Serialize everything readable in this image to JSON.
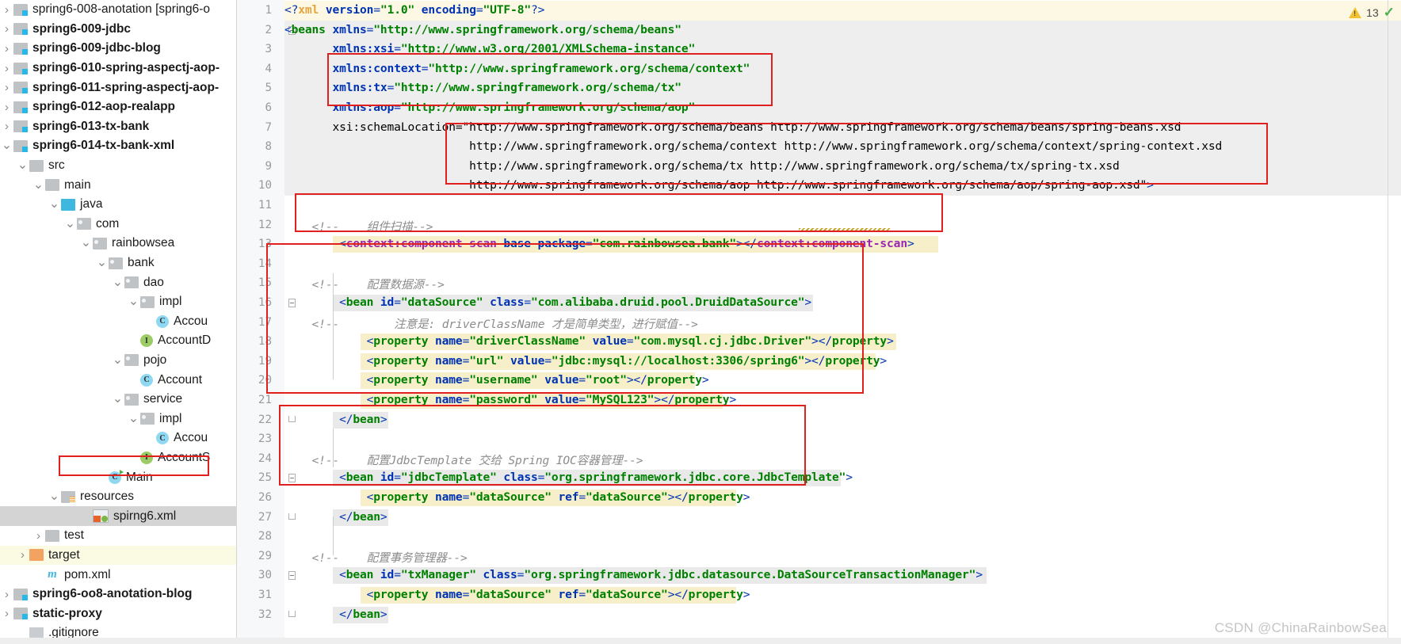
{
  "sidebar": {
    "items": [
      {
        "label": "spring6-008-anotation [spring6-o",
        "indent": 0,
        "arrow": "right",
        "icon": "module-folder-icon",
        "bold": false,
        "state": "normal"
      },
      {
        "label": "spring6-009-jdbc",
        "indent": 0,
        "arrow": "right",
        "icon": "module-folder-icon",
        "bold": true,
        "state": "normal"
      },
      {
        "label": "spring6-009-jdbc-blog",
        "indent": 0,
        "arrow": "right",
        "icon": "module-folder-icon",
        "bold": true,
        "state": "normal"
      },
      {
        "label": "spring6-010-spring-aspectj-aop-",
        "indent": 0,
        "arrow": "right",
        "icon": "module-folder-icon",
        "bold": true,
        "state": "normal"
      },
      {
        "label": "spring6-011-spring-aspectj-aop-",
        "indent": 0,
        "arrow": "right",
        "icon": "module-folder-icon",
        "bold": true,
        "state": "normal"
      },
      {
        "label": "spring6-012-aop-realapp",
        "indent": 0,
        "arrow": "right",
        "icon": "module-folder-icon",
        "bold": true,
        "state": "normal"
      },
      {
        "label": "spring6-013-tx-bank",
        "indent": 0,
        "arrow": "right",
        "icon": "module-folder-icon",
        "bold": true,
        "state": "normal"
      },
      {
        "label": "spring6-014-tx-bank-xml",
        "indent": 0,
        "arrow": "down",
        "icon": "module-folder-icon",
        "bold": true,
        "state": "normal"
      },
      {
        "label": "src",
        "indent": 1,
        "arrow": "down",
        "icon": "folder-icon",
        "bold": false,
        "state": "normal"
      },
      {
        "label": "main",
        "indent": 2,
        "arrow": "down",
        "icon": "folder-icon",
        "bold": false,
        "state": "normal"
      },
      {
        "label": "java",
        "indent": 3,
        "arrow": "down",
        "icon": "source-root-icon",
        "bold": false,
        "state": "normal"
      },
      {
        "label": "com",
        "indent": 4,
        "arrow": "down",
        "icon": "package-icon",
        "bold": false,
        "state": "normal"
      },
      {
        "label": "rainbowsea",
        "indent": 5,
        "arrow": "down",
        "icon": "package-icon",
        "bold": false,
        "state": "normal"
      },
      {
        "label": "bank",
        "indent": 6,
        "arrow": "down",
        "icon": "package-icon",
        "bold": false,
        "state": "normal"
      },
      {
        "label": "dao",
        "indent": 7,
        "arrow": "down",
        "icon": "package-icon",
        "bold": false,
        "state": "normal"
      },
      {
        "label": "impl",
        "indent": 8,
        "arrow": "down",
        "icon": "package-icon",
        "bold": false,
        "state": "normal"
      },
      {
        "label": "Accou",
        "indent": 9,
        "arrow": "none",
        "icon": "class-icon",
        "bold": false,
        "state": "normal"
      },
      {
        "label": "AccountD",
        "indent": 8,
        "arrow": "none",
        "icon": "interface-icon",
        "bold": false,
        "state": "normal"
      },
      {
        "label": "pojo",
        "indent": 7,
        "arrow": "down",
        "icon": "package-icon",
        "bold": false,
        "state": "normal"
      },
      {
        "label": "Account",
        "indent": 8,
        "arrow": "none",
        "icon": "class-icon",
        "bold": false,
        "state": "normal"
      },
      {
        "label": "service",
        "indent": 7,
        "arrow": "down",
        "icon": "package-icon",
        "bold": false,
        "state": "normal"
      },
      {
        "label": "impl",
        "indent": 8,
        "arrow": "down",
        "icon": "package-icon",
        "bold": false,
        "state": "normal"
      },
      {
        "label": "Accou",
        "indent": 9,
        "arrow": "none",
        "icon": "class-icon",
        "bold": false,
        "state": "normal"
      },
      {
        "label": "AccountS",
        "indent": 8,
        "arrow": "none",
        "icon": "interface-icon",
        "bold": false,
        "state": "normal"
      },
      {
        "label": "Main",
        "indent": 6,
        "arrow": "none",
        "icon": "main-class-icon",
        "bold": false,
        "state": "normal"
      },
      {
        "label": "resources",
        "indent": 3,
        "arrow": "down",
        "icon": "resources-root-icon",
        "bold": false,
        "state": "normal"
      },
      {
        "label": "spirng6.xml",
        "indent": 5,
        "arrow": "none",
        "icon": "spring-xml-icon",
        "bold": false,
        "state": "selected"
      },
      {
        "label": "test",
        "indent": 2,
        "arrow": "right",
        "icon": "folder-icon",
        "bold": false,
        "state": "normal"
      },
      {
        "label": "target",
        "indent": 1,
        "arrow": "right",
        "icon": "target-folder-icon",
        "bold": false,
        "state": "highlight"
      },
      {
        "label": "pom.xml",
        "indent": 2,
        "arrow": "none",
        "icon": "maven-icon",
        "bold": false,
        "state": "normal"
      },
      {
        "label": "spring6-oo8-anotation-blog",
        "indent": 0,
        "arrow": "right",
        "icon": "module-folder-icon",
        "bold": true,
        "state": "normal"
      },
      {
        "label": "static-proxy",
        "indent": 0,
        "arrow": "right",
        "icon": "module-folder-icon",
        "bold": true,
        "state": "normal"
      },
      {
        "label": ".gitignore",
        "indent": 1,
        "arrow": "none",
        "icon": "gitignore-icon",
        "bold": false,
        "state": "normal"
      }
    ]
  },
  "editor": {
    "warning_count": "13",
    "warning_icon": "warning-triangle-icon",
    "ok_icon": "checkmark-icon",
    "line_numbers": [
      "1",
      "2",
      "3",
      "4",
      "5",
      "6",
      "7",
      "8",
      "9",
      "10",
      "11",
      "12",
      "13",
      "14",
      "15",
      "16",
      "17",
      "18",
      "19",
      "20",
      "21",
      "22",
      "23",
      "24",
      "25",
      "26",
      "27",
      "28",
      "29",
      "30",
      "31",
      "32"
    ],
    "lines": [
      {
        "n": "1",
        "text": "<?xml version=\"1.0\" encoding=\"UTF-8\"?>"
      },
      {
        "n": "2",
        "text": "<beans xmlns=\"http://www.springframework.org/schema/beans\""
      },
      {
        "n": "3",
        "text": "       xmlns:xsi=\"http://www.w3.org/2001/XMLSchema-instance\""
      },
      {
        "n": "4",
        "text": "       xmlns:context=\"http://www.springframework.org/schema/context\""
      },
      {
        "n": "5",
        "text": "       xmlns:tx=\"http://www.springframework.org/schema/tx\""
      },
      {
        "n": "6",
        "text": "       xmlns:aop=\"http://www.springframework.org/schema/aop\""
      },
      {
        "n": "7",
        "text": "       xsi:schemaLocation=\"http://www.springframework.org/schema/beans http://www.springframework.org/schema/beans/spring-beans.xsd"
      },
      {
        "n": "8",
        "text": "                           http://www.springframework.org/schema/context http://www.springframework.org/schema/context/spring-context.xsd"
      },
      {
        "n": "9",
        "text": "                           http://www.springframework.org/schema/tx http://www.springframework.org/schema/tx/spring-tx.xsd"
      },
      {
        "n": "10",
        "text": "                           http://www.springframework.org/schema/aop http://www.springframework.org/schema/aop/spring-aop.xsd\">"
      },
      {
        "n": "11",
        "text": ""
      },
      {
        "n": "12",
        "text": "    <!--    组件扫描-->"
      },
      {
        "n": "13",
        "text": "        <context:component-scan base-package=\"com.rainbowsea.bank\"></context:component-scan>"
      },
      {
        "n": "14",
        "text": ""
      },
      {
        "n": "15",
        "text": "    <!--    配置数据源-->"
      },
      {
        "n": "16",
        "text": "        <bean id=\"dataSource\" class=\"com.alibaba.druid.pool.DruidDataSource\">"
      },
      {
        "n": "17",
        "text": "    <!--        注意是: driverClassName 才是简单类型，进行赋值-->"
      },
      {
        "n": "18",
        "text": "            <property name=\"driverClassName\" value=\"com.mysql.cj.jdbc.Driver\"></property>"
      },
      {
        "n": "19",
        "text": "            <property name=\"url\" value=\"jdbc:mysql://localhost:3306/spring6\"></property>"
      },
      {
        "n": "20",
        "text": "            <property name=\"username\" value=\"root\"></property>"
      },
      {
        "n": "21",
        "text": "            <property name=\"password\" value=\"MySQL123\"></property>"
      },
      {
        "n": "22",
        "text": "        </bean>"
      },
      {
        "n": "23",
        "text": ""
      },
      {
        "n": "24",
        "text": "    <!--    配置JdbcTemplate 交给 Spring IOC容器管理-->"
      },
      {
        "n": "25",
        "text": "        <bean id=\"jdbcTemplate\" class=\"org.springframework.jdbc.core.JdbcTemplate\">"
      },
      {
        "n": "26",
        "text": "            <property name=\"dataSource\" ref=\"dataSource\"></property>"
      },
      {
        "n": "27",
        "text": "        </bean>"
      },
      {
        "n": "28",
        "text": ""
      },
      {
        "n": "29",
        "text": "    <!--    配置事务管理器-->"
      },
      {
        "n": "30",
        "text": "        <bean id=\"txManager\" class=\"org.springframework.jdbc.datasource.DataSourceTransactionManager\">"
      },
      {
        "n": "31",
        "text": "            <property name=\"dataSource\" ref=\"dataSource\"></property>"
      },
      {
        "n": "32",
        "text": "        </bean>"
      }
    ],
    "annotations": {
      "red_box_count": 5,
      "red_box_color": "#e01f1f"
    }
  },
  "watermark": {
    "text": "CSDN @ChinaRainbowSea"
  }
}
